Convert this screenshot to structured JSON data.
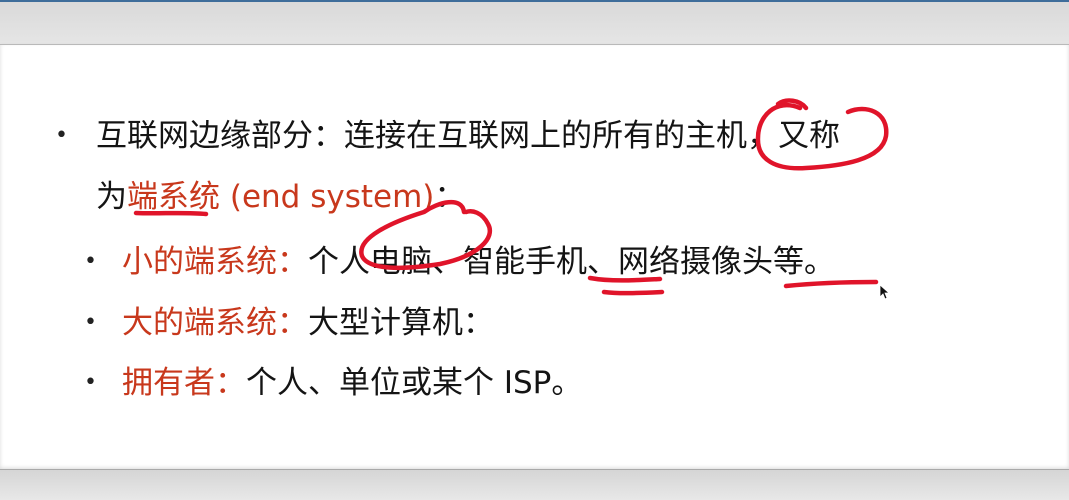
{
  "slide": {
    "bullet_glyph": "•",
    "main_point": {
      "line1_text": "互联网边缘部分：连接在互联网上的所有的主机，又称",
      "line2_prefix": "为",
      "line2_highlight": "端系统 (end system)",
      "line2_suffix": "："
    },
    "sub_points": [
      {
        "label": "小的端系统：",
        "text": "个人电脑、智能手机、网络摄像头等。"
      },
      {
        "label": "大的端系统：",
        "text": "大型计算机："
      },
      {
        "label": "拥有者：",
        "text": "个人、单位或某个 ISP。"
      }
    ]
  },
  "colors": {
    "highlight_text": "#c8381c",
    "annotation_ink": "#e0142a",
    "body_text": "#141414"
  },
  "annotations": {
    "pen": "red-freehand-marks",
    "cursor_icon": "mouse-pointer-icon"
  }
}
